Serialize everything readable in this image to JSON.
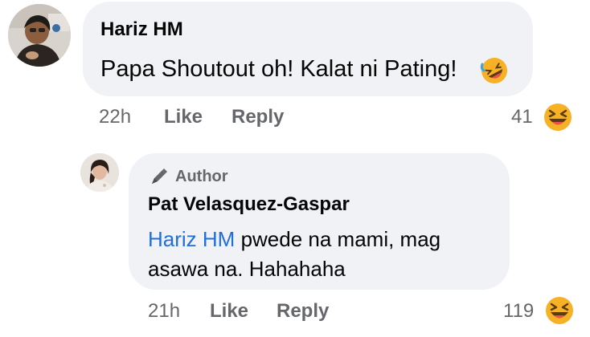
{
  "comments": [
    {
      "author": "Hariz HM",
      "text": "Papa Shoutout oh! Kalat ni Pating!",
      "time": "22h",
      "like_label": "Like",
      "reply_label": "Reply",
      "reaction_count": "41",
      "reaction_icon": "laughing-face-icon",
      "text_emoji_icon": "rolling-laughing-face-icon"
    },
    {
      "badge": "Author",
      "author": "Pat Velasquez-Gaspar",
      "mention": "Hariz HM",
      "text_line1": " pwede na mami, mag",
      "text_line2": "asawa na. Hahahaha",
      "time": "21h",
      "like_label": "Like",
      "reply_label": "Reply",
      "reaction_count": "119",
      "reaction_icon": "laughing-face-icon"
    }
  ],
  "colors": {
    "bubble": "#f0f2f5",
    "meta": "#65676b",
    "mention": "#216fdb",
    "emoji_yellow": "#f7b125"
  }
}
